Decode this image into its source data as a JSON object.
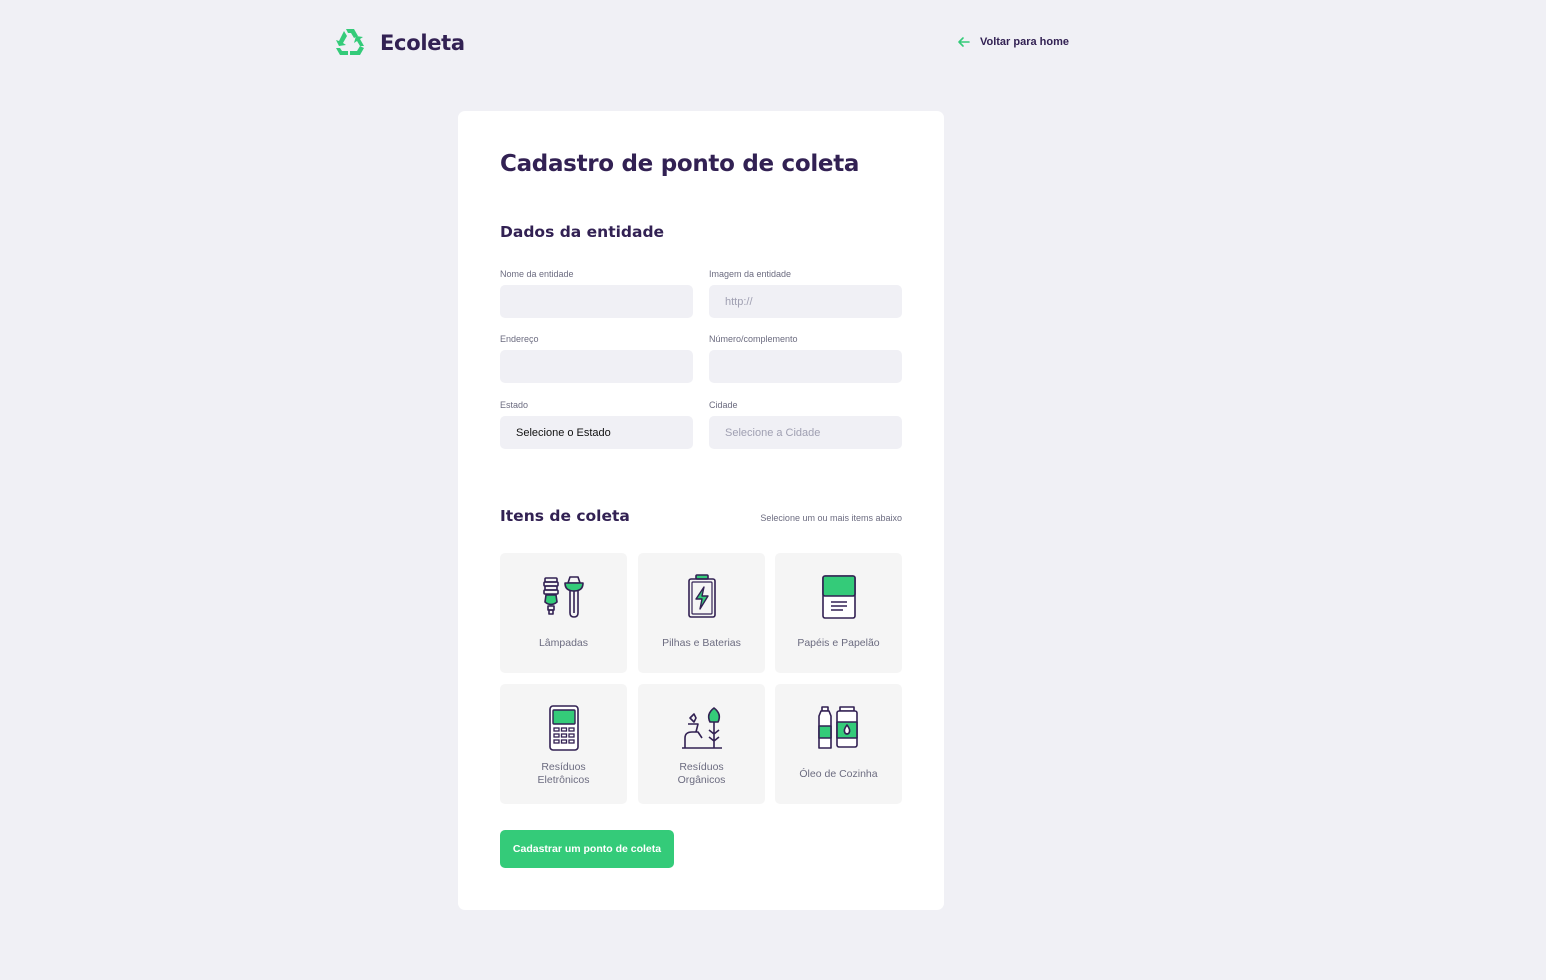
{
  "header": {
    "logo_text": "Ecoleta",
    "back_label": "Voltar para home",
    "accent": "#34cb79"
  },
  "form": {
    "title": "Cadastro de ponto de coleta",
    "entity_section": "Dados da entidade",
    "fields": {
      "name": {
        "label": "Nome da entidade",
        "value": ""
      },
      "image": {
        "label": "Imagem da entidade",
        "placeholder": "http://"
      },
      "address": {
        "label": "Endereço",
        "value": ""
      },
      "number": {
        "label": "Número/complemento",
        "value": ""
      },
      "state": {
        "label": "Estado",
        "value": "Selecione o Estado"
      },
      "city": {
        "label": "Cidade",
        "placeholder": "Selecione a Cidade"
      }
    },
    "items_section": "Itens de coleta",
    "items_hint": "Selecione um ou mais items abaixo",
    "items": [
      {
        "label": "Lâmpadas",
        "icon": "lamp-icon"
      },
      {
        "label": "Pilhas e Baterias",
        "icon": "battery-icon"
      },
      {
        "label": "Papéis e Papelão",
        "icon": "paper-icon"
      },
      {
        "label": "Resíduos Eletrônicos",
        "icon": "electronics-icon"
      },
      {
        "label": "Resíduos Orgânicos",
        "icon": "organic-icon"
      },
      {
        "label": "Óleo de Cozinha",
        "icon": "oil-icon"
      }
    ],
    "submit_label": "Cadastrar um ponto de coleta"
  }
}
